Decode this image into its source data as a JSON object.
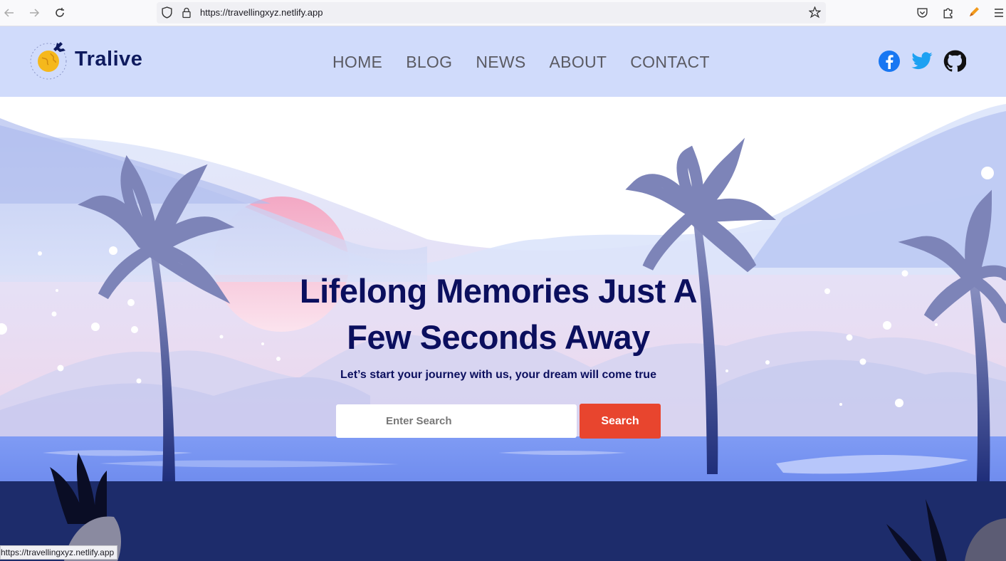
{
  "browser": {
    "url": "https://travellingxyz.netlify.app",
    "status_url": "https://travellingxyz.netlify.app",
    "icons": [
      "back-icon",
      "forward-icon",
      "reload-icon",
      "shield-icon",
      "lock-icon",
      "bookmark-star-icon",
      "pocket-icon",
      "extensions-icon",
      "pencil-icon",
      "menu-icon"
    ]
  },
  "header": {
    "logo_text": "Tralive",
    "nav": [
      {
        "label": "HOME"
      },
      {
        "label": "BLOG"
      },
      {
        "label": "NEWS"
      },
      {
        "label": "ABOUT"
      },
      {
        "label": "CONTACT"
      }
    ],
    "social": [
      "facebook-icon",
      "twitter-icon",
      "github-icon"
    ]
  },
  "hero": {
    "title_line1": "Lifelong Memories Just A",
    "title_line2": "Few Seconds Away",
    "subtitle": "Let’s start your journey with us, your dream will come true",
    "search_placeholder": "Enter Search",
    "search_button": "Search"
  },
  "colors": {
    "header_bg": "#d0dbfb",
    "accent": "#e8452e",
    "title": "#0b0f5e"
  }
}
